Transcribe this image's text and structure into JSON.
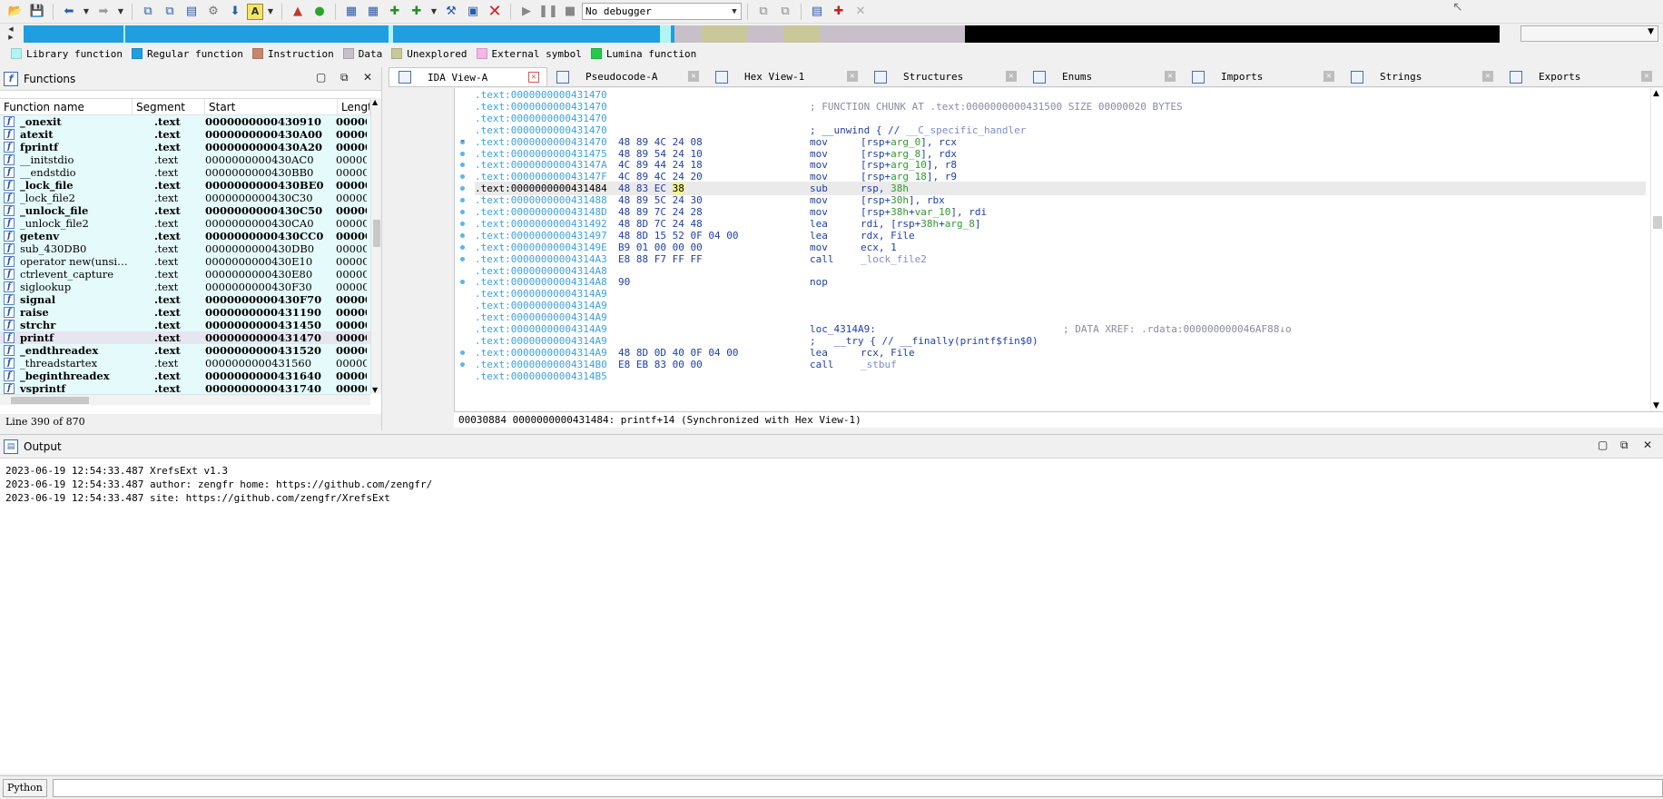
{
  "toolbar": {
    "icons": [
      "open-icon",
      "save-icon",
      "back-icon",
      "back-dropdown-icon",
      "forward-icon",
      "forward-dropdown-icon",
      "copy-icon",
      "paste-icon",
      "list-icon",
      "settings-icon",
      "jump-down-icon",
      "text-icon",
      "text-dropdown-icon",
      "graph-icon",
      "green-circle-icon",
      "add-icon",
      "add2-icon",
      "add3-icon",
      "add4-icon",
      "dropdown-icon",
      "tools-icon",
      "build-icon",
      "close-red-icon",
      "run-icon",
      "pause-icon",
      "stop-icon"
    ],
    "debugger_value": "No debugger",
    "right_icons": [
      "attach-icon",
      "detach-icon",
      "breakpoints-icon",
      "add-breakpoint-icon",
      "remove-breakpoint-icon"
    ]
  },
  "legend": [
    {
      "label": "Library function",
      "color": "#b4f3f3"
    },
    {
      "label": "Regular function",
      "color": "#1f9ee0"
    },
    {
      "label": "Instruction",
      "color": "#c7876a"
    },
    {
      "label": "Data",
      "color": "#c8c0c8"
    },
    {
      "label": "Unexplored",
      "color": "#c8c89a"
    },
    {
      "label": "External symbol",
      "color": "#f5b6e8"
    },
    {
      "label": "Lumina function",
      "color": "#27c94a"
    }
  ],
  "functions_panel": {
    "title": "Functions",
    "columns": [
      "Function name",
      "Segment",
      "Start",
      "Lengt"
    ],
    "rows": [
      {
        "name": "_onexit",
        "seg": ".text",
        "start": "0000000000430910",
        "len": "00000",
        "bold": true
      },
      {
        "name": "atexit",
        "seg": ".text",
        "start": "0000000000430A00",
        "len": "00000",
        "bold": true
      },
      {
        "name": "fprintf",
        "seg": ".text",
        "start": "0000000000430A20",
        "len": "00000",
        "bold": true
      },
      {
        "name": "__initstdio",
        "seg": ".text",
        "start": "0000000000430AC0",
        "len": "00000",
        "bold": false
      },
      {
        "name": "__endstdio",
        "seg": ".text",
        "start": "0000000000430BB0",
        "len": "00000",
        "bold": false
      },
      {
        "name": "_lock_file",
        "seg": ".text",
        "start": "0000000000430BE0",
        "len": "00000",
        "bold": true
      },
      {
        "name": "_lock_file2",
        "seg": ".text",
        "start": "0000000000430C30",
        "len": "00000",
        "bold": false
      },
      {
        "name": "_unlock_file",
        "seg": ".text",
        "start": "0000000000430C50",
        "len": "00000",
        "bold": true
      },
      {
        "name": "_unlock_file2",
        "seg": ".text",
        "start": "0000000000430CA0",
        "len": "00000",
        "bold": false
      },
      {
        "name": "getenv",
        "seg": ".text",
        "start": "0000000000430CC0",
        "len": "00000",
        "bold": true
      },
      {
        "name": "sub_430DB0",
        "seg": ".text",
        "start": "0000000000430DB0",
        "len": "00000",
        "bold": false
      },
      {
        "name": "operator new(unsi…",
        "seg": ".text",
        "start": "0000000000430E10",
        "len": "00000",
        "bold": false
      },
      {
        "name": "ctrlevent_capture",
        "seg": ".text",
        "start": "0000000000430E80",
        "len": "00000",
        "bold": false
      },
      {
        "name": "siglookup",
        "seg": ".text",
        "start": "0000000000430F30",
        "len": "00000",
        "bold": false
      },
      {
        "name": "signal",
        "seg": ".text",
        "start": "0000000000430F70",
        "len": "00000",
        "bold": true
      },
      {
        "name": "raise",
        "seg": ".text",
        "start": "0000000000431190",
        "len": "00000",
        "bold": true
      },
      {
        "name": "strchr",
        "seg": ".text",
        "start": "0000000000431450",
        "len": "00000",
        "bold": true
      },
      {
        "name": "printf",
        "seg": ".text",
        "start": "0000000000431470",
        "len": "00000",
        "bold": true,
        "selected": true
      },
      {
        "name": "_endthreadex",
        "seg": ".text",
        "start": "0000000000431520",
        "len": "00000",
        "bold": true
      },
      {
        "name": "_threadstartex",
        "seg": ".text",
        "start": "0000000000431560",
        "len": "00000",
        "bold": false
      },
      {
        "name": "_beginthreadex",
        "seg": ".text",
        "start": "0000000000431640",
        "len": "00000",
        "bold": true
      },
      {
        "name": "vsprintf",
        "seg": ".text",
        "start": "0000000000431740",
        "len": "00000",
        "bold": true
      }
    ],
    "status": "Line 390 of 870"
  },
  "tabs": [
    {
      "label": "IDA View-A",
      "icon": "ida-view-icon",
      "active": true
    },
    {
      "label": "Pseudocode-A",
      "icon": "pseudocode-icon",
      "active": false
    },
    {
      "label": "Hex View-1",
      "icon": "hex-view-icon",
      "active": false
    },
    {
      "label": "Structures",
      "icon": "structures-icon",
      "active": false
    },
    {
      "label": "Enums",
      "icon": "enums-icon",
      "active": false
    },
    {
      "label": "Imports",
      "icon": "imports-icon",
      "active": false
    },
    {
      "label": "Strings",
      "icon": "strings-icon",
      "active": false
    },
    {
      "label": "Exports",
      "icon": "exports-icon",
      "active": false
    }
  ],
  "disasm": [
    {
      "addr": ".text:0000000000431470",
      "bytes": "",
      "mn": "",
      "op": "",
      "comment": "",
      "dot": false
    },
    {
      "addr": ".text:0000000000431470",
      "bytes": "",
      "mn": "",
      "op": "",
      "comment": "; FUNCTION CHUNK AT .text:0000000000431500 SIZE 00000020 BYTES",
      "dot": false
    },
    {
      "addr": ".text:0000000000431470",
      "bytes": "",
      "mn": "",
      "op": "",
      "comment": "",
      "dot": false
    },
    {
      "addr": ".text:0000000000431470",
      "bytes": "",
      "mn": "",
      "op": "",
      "label": "; __unwind { // __C_specific_handler",
      "dot": false
    },
    {
      "addr": ".text:0000000000431470",
      "bytes": "48 89 4C 24 08",
      "mn": "mov",
      "op": "[rsp+arg_0], rcx",
      "dot": true
    },
    {
      "addr": ".text:0000000000431475",
      "bytes": "48 89 54 24 10",
      "mn": "mov",
      "op": "[rsp+arg_8], rdx",
      "dot": true
    },
    {
      "addr": ".text:000000000043147A",
      "bytes": "4C 89 44 24 18",
      "mn": "mov",
      "op": "[rsp+arg_10], r8",
      "dot": true
    },
    {
      "addr": ".text:000000000043147F",
      "bytes": "4C 89 4C 24 20",
      "mn": "mov",
      "op": "[rsp+arg_18], r9",
      "dot": true
    },
    {
      "addr": ".text:0000000000431484",
      "bytes": "48 83 EC 38",
      "mn": "sub",
      "op": "rsp, 38h",
      "dot": true,
      "hl": true
    },
    {
      "addr": ".text:0000000000431488",
      "bytes": "48 89 5C 24 30",
      "mn": "mov",
      "op": "[rsp+30h], rbx",
      "dot": true
    },
    {
      "addr": ".text:000000000043148D",
      "bytes": "48 89 7C 24 28",
      "mn": "mov",
      "op": "[rsp+38h+var_10], rdi",
      "dot": true
    },
    {
      "addr": ".text:0000000000431492",
      "bytes": "48 8D 7C 24 48",
      "mn": "lea",
      "op": "rdi, [rsp+38h+arg_8]",
      "dot": true
    },
    {
      "addr": ".text:0000000000431497",
      "bytes": "48 8D 15 52 0F 04 00",
      "mn": "lea",
      "op": "rdx, File",
      "dot": true
    },
    {
      "addr": ".text:000000000043149E",
      "bytes": "B9 01 00 00 00",
      "mn": "mov",
      "op": "ecx, 1",
      "dot": true
    },
    {
      "addr": ".text:00000000004314A3",
      "bytes": "E8 88 F7 FF FF",
      "mn": "call",
      "op": "_lock_file2",
      "dot": true
    },
    {
      "addr": ".text:00000000004314A8",
      "bytes": "",
      "mn": "",
      "op": "",
      "dot": false
    },
    {
      "addr": ".text:00000000004314A8",
      "bytes": "90",
      "mn": "nop",
      "op": "",
      "dot": true
    },
    {
      "addr": ".text:00000000004314A9",
      "bytes": "",
      "mn": "",
      "op": "",
      "dot": false
    },
    {
      "addr": ".text:00000000004314A9",
      "bytes": "",
      "mn": "",
      "op": "",
      "dot": false
    },
    {
      "addr": ".text:00000000004314A9",
      "bytes": "",
      "mn": "",
      "op": "",
      "dot": false
    },
    {
      "addr": ".text:00000000004314A9",
      "bytes": "",
      "mn": "",
      "op": "",
      "label": "loc_4314A9:",
      "xref": "; DATA XREF: .rdata:000000000046AF88↓o",
      "dot": false
    },
    {
      "addr": ".text:00000000004314A9",
      "bytes": "",
      "mn": "",
      "op": "",
      "label": ";   __try { // __finally(printf$fin$0)",
      "dot": false
    },
    {
      "addr": ".text:00000000004314A9",
      "bytes": "48 8D 0D 40 0F 04 00",
      "mn": "lea",
      "op": "rcx, File",
      "dot": true
    },
    {
      "addr": ".text:00000000004314B0",
      "bytes": "E8 EB 83 00 00",
      "mn": "call",
      "op": "_stbuf",
      "dot": true
    },
    {
      "addr": ".text:00000000004314B5",
      "bytes": "",
      "mn": "",
      "op": "",
      "dot": false
    }
  ],
  "ida_status": "00030884 0000000000431484: printf+14 (Synchronized with Hex View-1)",
  "output_panel": {
    "title": "Output",
    "lines": [
      "2023-06-19 12:54:33.487 XrefsExt v1.3",
      "2023-06-19 12:54:33.487 author: zengfr home: https://github.com/zengfr/",
      "2023-06-19 12:54:33.487 site: https://github.com/zengfr/XrefsExt"
    ]
  },
  "cli": {
    "button": "Python",
    "value": ""
  }
}
